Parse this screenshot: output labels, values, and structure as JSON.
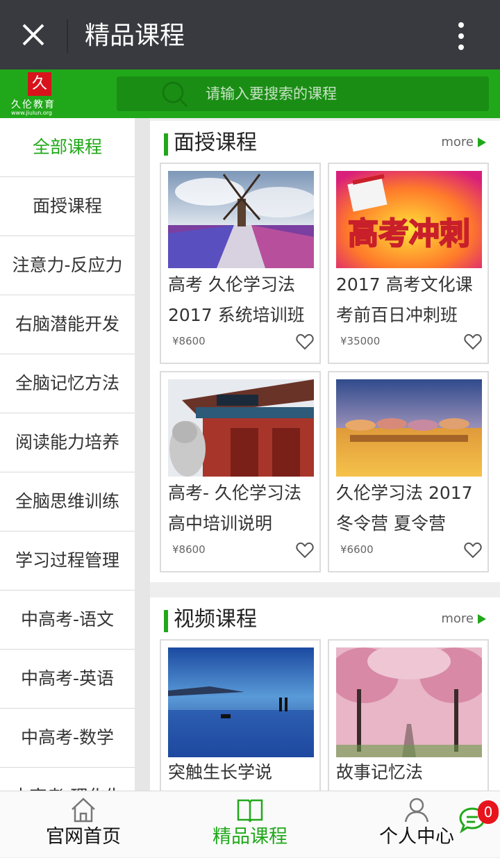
{
  "titlebar": {
    "title": "精品课程"
  },
  "search": {
    "placeholder": "请输入要搜索的课程",
    "logo_name": "久伦教育",
    "logo_url": "www.jiulun.org"
  },
  "sidebar": {
    "items": [
      {
        "label": "全部课程",
        "active": true
      },
      {
        "label": "面授课程"
      },
      {
        "label": "注意力-反应力"
      },
      {
        "label": "右脑潜能开发"
      },
      {
        "label": "全脑记忆方法"
      },
      {
        "label": "阅读能力培养"
      },
      {
        "label": "全脑思维训练"
      },
      {
        "label": "学习过程管理"
      },
      {
        "label": "中高考-语文"
      },
      {
        "label": "中高考-英语"
      },
      {
        "label": "中高考-数学"
      },
      {
        "label": "中高考-理化生"
      }
    ]
  },
  "sections": [
    {
      "title": "面授课程",
      "more": "more",
      "cards": [
        {
          "title": "高考 久伦学习法 2017 系统培训班",
          "price": "¥8600"
        },
        {
          "title": "2017 高考文化课考前百日冲刺班",
          "price": "¥35000",
          "img_text": "高考冲刺"
        },
        {
          "title": "高考- 久伦学习法 高中培训说明",
          "price": "¥8600"
        },
        {
          "title": "久伦学习法 2017 冬令营 夏令营",
          "price": "¥6600"
        }
      ]
    },
    {
      "title": "视频课程",
      "more": "more",
      "cards": [
        {
          "title": "突触生长学说"
        },
        {
          "title": "故事记忆法"
        }
      ]
    }
  ],
  "tabbar": {
    "tabs": [
      {
        "label": "官网首页",
        "icon": "home-icon"
      },
      {
        "label": "精品课程",
        "icon": "book-icon",
        "active": true
      },
      {
        "label": "个人中心",
        "icon": "user-icon"
      }
    ],
    "badge": "0"
  },
  "colors": {
    "accent": "#21a81a",
    "titlebar": "#393a3f",
    "badge": "#e8141c"
  }
}
